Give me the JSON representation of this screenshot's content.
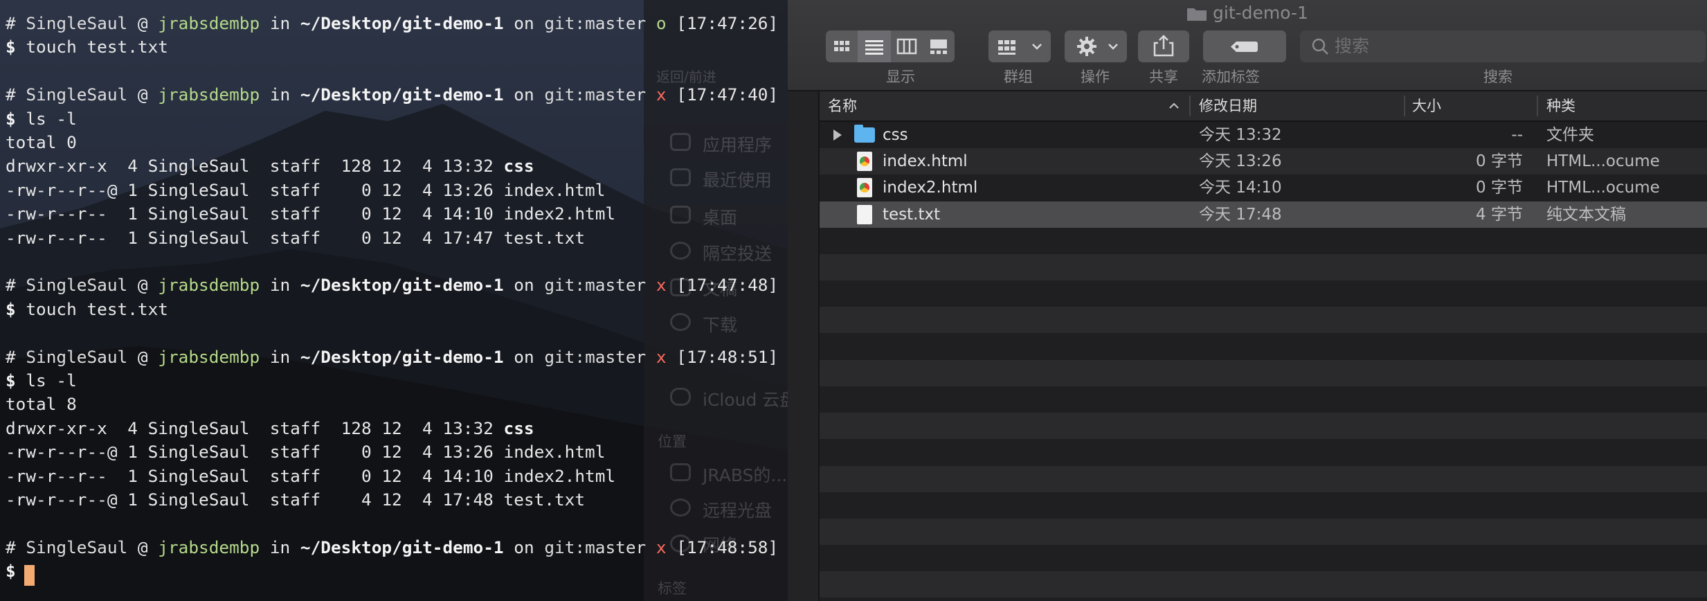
{
  "terminal": {
    "lines": [
      {
        "segments": [
          {
            "t": "# ",
            "c": "c-white"
          },
          {
            "t": "SingleSaul",
            "c": "c-gray"
          },
          {
            "t": " @ ",
            "c": "c-white"
          },
          {
            "t": "jrabsdembp",
            "c": "c-green"
          },
          {
            "t": " in ",
            "c": "c-white"
          },
          {
            "t": "~/Desktop/git-demo-1",
            "c": "c-bold"
          },
          {
            "t": " on ",
            "c": "c-white"
          },
          {
            "t": "git:master",
            "c": "c-gray"
          },
          {
            "t": " o",
            "c": "c-greenflag"
          },
          {
            "t": " [17:47:26]",
            "c": "c-white"
          }
        ]
      },
      {
        "segments": [
          {
            "t": "$ ",
            "c": "c-bold"
          },
          {
            "t": "touch test.txt",
            "c": "c-white"
          }
        ]
      },
      {
        "segments": []
      },
      {
        "segments": [
          {
            "t": "# ",
            "c": "c-white"
          },
          {
            "t": "SingleSaul",
            "c": "c-gray"
          },
          {
            "t": " @ ",
            "c": "c-white"
          },
          {
            "t": "jrabsdembp",
            "c": "c-green"
          },
          {
            "t": " in ",
            "c": "c-white"
          },
          {
            "t": "~/Desktop/git-demo-1",
            "c": "c-bold"
          },
          {
            "t": " on ",
            "c": "c-white"
          },
          {
            "t": "git:master",
            "c": "c-gray"
          },
          {
            "t": " x",
            "c": "c-red"
          },
          {
            "t": " [17:47:40]",
            "c": "c-white"
          }
        ]
      },
      {
        "segments": [
          {
            "t": "$ ",
            "c": "c-bold"
          },
          {
            "t": "ls -l",
            "c": "c-white"
          }
        ]
      },
      {
        "segments": [
          {
            "t": "total 0",
            "c": "c-white"
          }
        ]
      },
      {
        "segments": [
          {
            "t": "drwxr-xr-x  4 SingleSaul  staff  128 12  4 13:32 ",
            "c": "c-white"
          },
          {
            "t": "css",
            "c": "c-bold"
          }
        ]
      },
      {
        "segments": [
          {
            "t": "-rw-r--r--@ 1 SingleSaul  staff    0 12  4 13:26 index.html",
            "c": "c-white"
          }
        ]
      },
      {
        "segments": [
          {
            "t": "-rw-r--r--  1 SingleSaul  staff    0 12  4 14:10 index2.html",
            "c": "c-white"
          }
        ]
      },
      {
        "segments": [
          {
            "t": "-rw-r--r--  1 SingleSaul  staff    0 12  4 17:47 test.txt",
            "c": "c-white"
          }
        ]
      },
      {
        "segments": []
      },
      {
        "segments": [
          {
            "t": "# ",
            "c": "c-white"
          },
          {
            "t": "SingleSaul",
            "c": "c-gray"
          },
          {
            "t": " @ ",
            "c": "c-white"
          },
          {
            "t": "jrabsdembp",
            "c": "c-green"
          },
          {
            "t": " in ",
            "c": "c-white"
          },
          {
            "t": "~/Desktop/git-demo-1",
            "c": "c-bold"
          },
          {
            "t": " on ",
            "c": "c-white"
          },
          {
            "t": "git:master",
            "c": "c-gray"
          },
          {
            "t": " x",
            "c": "c-red"
          },
          {
            "t": " [17:47:48]",
            "c": "c-white"
          }
        ]
      },
      {
        "segments": [
          {
            "t": "$ ",
            "c": "c-bold"
          },
          {
            "t": "touch test.txt",
            "c": "c-white"
          }
        ]
      },
      {
        "segments": []
      },
      {
        "segments": [
          {
            "t": "# ",
            "c": "c-white"
          },
          {
            "t": "SingleSaul",
            "c": "c-gray"
          },
          {
            "t": " @ ",
            "c": "c-white"
          },
          {
            "t": "jrabsdembp",
            "c": "c-green"
          },
          {
            "t": " in ",
            "c": "c-white"
          },
          {
            "t": "~/Desktop/git-demo-1",
            "c": "c-bold"
          },
          {
            "t": " on ",
            "c": "c-white"
          },
          {
            "t": "git:master",
            "c": "c-gray"
          },
          {
            "t": " x",
            "c": "c-red"
          },
          {
            "t": " [17:48:51]",
            "c": "c-white"
          }
        ]
      },
      {
        "segments": [
          {
            "t": "$ ",
            "c": "c-bold"
          },
          {
            "t": "ls -l",
            "c": "c-white"
          }
        ]
      },
      {
        "segments": [
          {
            "t": "total 8",
            "c": "c-white"
          }
        ]
      },
      {
        "segments": [
          {
            "t": "drwxr-xr-x  4 SingleSaul  staff  128 12  4 13:32 ",
            "c": "c-white"
          },
          {
            "t": "css",
            "c": "c-bold"
          }
        ]
      },
      {
        "segments": [
          {
            "t": "-rw-r--r--@ 1 SingleSaul  staff    0 12  4 13:26 index.html",
            "c": "c-white"
          }
        ]
      },
      {
        "segments": [
          {
            "t": "-rw-r--r--  1 SingleSaul  staff    0 12  4 14:10 index2.html",
            "c": "c-white"
          }
        ]
      },
      {
        "segments": [
          {
            "t": "-rw-r--r--@ 1 SingleSaul  staff    4 12  4 17:48 test.txt",
            "c": "c-white"
          }
        ]
      },
      {
        "segments": []
      },
      {
        "segments": [
          {
            "t": "# ",
            "c": "c-white"
          },
          {
            "t": "SingleSaul",
            "c": "c-gray"
          },
          {
            "t": " @ ",
            "c": "c-white"
          },
          {
            "t": "jrabsdembp",
            "c": "c-green"
          },
          {
            "t": " in ",
            "c": "c-white"
          },
          {
            "t": "~/Desktop/git-demo-1",
            "c": "c-bold"
          },
          {
            "t": " on ",
            "c": "c-white"
          },
          {
            "t": "git:master",
            "c": "c-gray"
          },
          {
            "t": " x",
            "c": "c-red"
          },
          {
            "t": " [17:48:58]",
            "c": "c-white"
          }
        ]
      },
      {
        "segments": [
          {
            "t": "$ ",
            "c": "c-bold"
          }
        ]
      }
    ],
    "cursor_color": "#f4ab72"
  },
  "finder_sidebar_ghost": {
    "nav_label": "返回/前进",
    "favorites": [
      "应用程序",
      "最近使用",
      "桌面",
      "隔空投送",
      "文稿",
      "下载"
    ],
    "icloud": "iCloud 云盘",
    "locations_header": "位置",
    "locations": [
      "JRABS的...",
      "远程光盘",
      "网络"
    ],
    "tags_header": "标签"
  },
  "finder": {
    "title": "git-demo-1",
    "toolbar": {
      "display_label": "显示",
      "group_label": "群组",
      "action_label": "操作",
      "share_label": "共享",
      "tag_label": "添加标签",
      "search_placeholder": "搜索",
      "search_label": "搜索"
    },
    "columns": {
      "name": "名称",
      "modified": "修改日期",
      "size": "大小",
      "kind": "种类"
    },
    "rows": [
      {
        "name": "css",
        "modified": "今天 13:32",
        "size": "--",
        "kind": "文件夹",
        "icon": "folder-icon"
      },
      {
        "name": "index.html",
        "modified": "今天 13:26",
        "size": "0 字节",
        "kind": "HTML...ocume",
        "icon": "chrome-doc-icon"
      },
      {
        "name": "index2.html",
        "modified": "今天 14:10",
        "size": "0 字节",
        "kind": "HTML...ocume",
        "icon": "chrome-doc-icon"
      },
      {
        "name": "test.txt",
        "modified": "今天 17:48",
        "size": "4 字节",
        "kind": "纯文本文稿",
        "icon": "text-doc-icon"
      }
    ],
    "selected_row": 3
  }
}
